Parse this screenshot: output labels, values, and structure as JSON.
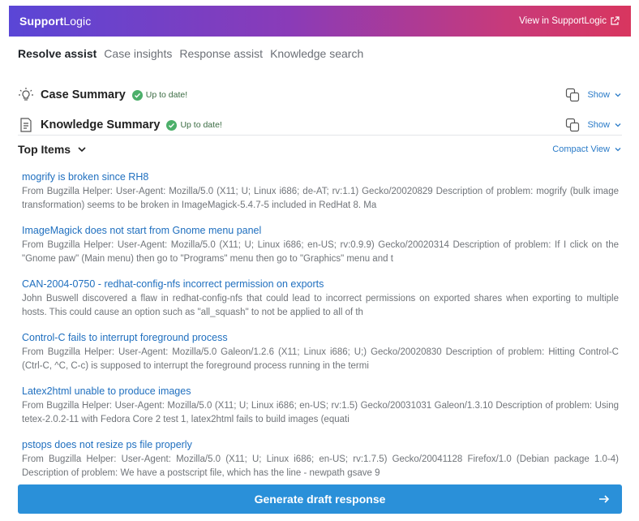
{
  "header": {
    "brand_bold": "Support",
    "brand_thin": "Logic",
    "external_link": "View in SupportLogic"
  },
  "tabs": [
    {
      "label": "Resolve assist",
      "active": true
    },
    {
      "label": "Case insights",
      "active": false
    },
    {
      "label": "Response assist",
      "active": false
    },
    {
      "label": "Knowledge search",
      "active": false
    }
  ],
  "case_summary": {
    "title": "Case Summary",
    "status": "Up to date!",
    "show": "Show",
    "icon": "lightbulb-icon"
  },
  "knowledge_summary": {
    "title": "Knowledge Summary",
    "status": "Up to date!",
    "show": "Show",
    "icon": "document-icon"
  },
  "top_items": {
    "title": "Top Items",
    "view_toggle": "Compact View",
    "items": [
      {
        "title": "mogrify is broken since RH8",
        "description": "From Bugzilla Helper: User-Agent: Mozilla/5.0 (X11; U; Linux i686; de-AT; rv:1.1) Gecko/20020829 Description of problem: mogrify (bulk image transformation) seems to be broken in ImageMagick-5.4.7-5 included in RedHat 8. Ma"
      },
      {
        "title": "ImageMagick does not start from Gnome menu panel",
        "description": "From Bugzilla Helper: User-Agent: Mozilla/5.0 (X11; U; Linux i686; en-US; rv:0.9.9) Gecko/20020314 Description of problem: If I click on the \"Gnome paw\" (Main menu) then go to \"Programs\" menu then go to \"Graphics\" menu and t"
      },
      {
        "title": "CAN-2004-0750 - redhat-config-nfs incorrect permission on exports",
        "description": "John Buswell discovered a flaw in redhat-config-nfs that could lead to incorrect permissions on exported shares when exporting to multiple hosts. This could cause an option such as \"all_squash\" to not be applied to all of th"
      },
      {
        "title": "Control-C fails to interrupt foreground process",
        "description": "From Bugzilla Helper: User-Agent: Mozilla/5.0 Galeon/1.2.6 (X11; Linux i686; U;) Gecko/20020830 Description of problem: Hitting Control-C (Ctrl-C, ^C, C-c) is supposed to interrupt the foreground process running in the termi"
      },
      {
        "title": "Latex2html unable to produce images",
        "description": "From Bugzilla Helper: User-Agent: Mozilla/5.0 (X11; U; Linux i686; en-US; rv:1.5) Gecko/20031031 Galeon/1.3.10 Description of problem: Using tetex-2.0.2-11 with Fedora Core 2 test 1, latex2html fails to build images (equati"
      },
      {
        "title": "pstops does not resize ps file properly",
        "description": "From Bugzilla Helper: User-Agent: Mozilla/5.0 (X11; U; Linux i686; en-US; rv:1.7.5) Gecko/20041128 Firefox/1.0 (Debian package 1.0-4) Description of problem: We have a postscript file, which has the line - newpath gsave 9"
      }
    ]
  },
  "footer": {
    "generate_label": "Generate draft response"
  },
  "colors": {
    "accent": "#2a90d9",
    "link": "#1f6fbf",
    "success": "#4caf6a"
  }
}
